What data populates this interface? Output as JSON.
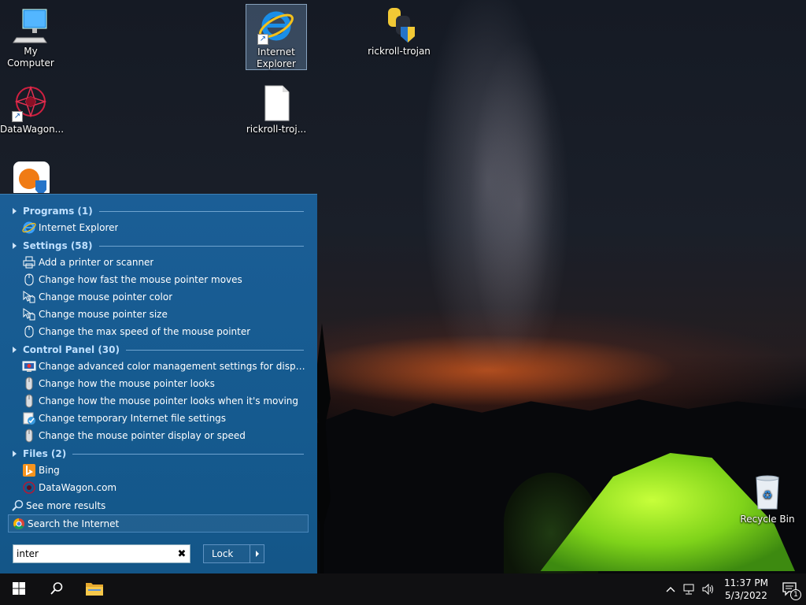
{
  "desktop": {
    "icons": [
      {
        "label": "My Computer"
      },
      {
        "label": "Internet Explorer"
      },
      {
        "label": "rickroll-trojan"
      },
      {
        "label": "DataWagon..."
      },
      {
        "label": "rickroll-troj..."
      },
      {
        "label": "Recycle Bin"
      }
    ]
  },
  "menu": {
    "groups": {
      "programs": "Programs (1)",
      "settings": "Settings (58)",
      "control_panel": "Control Panel (30)",
      "files": "Files (2)"
    },
    "programs": [
      "Internet Explorer"
    ],
    "settings": [
      "Add a printer or scanner",
      "Change how fast the mouse pointer moves",
      "Change mouse pointer color",
      "Change mouse pointer size",
      "Change the max speed of the mouse pointer"
    ],
    "control_panel": [
      "Change advanced color management settings for displays, sca...",
      "Change how the mouse pointer looks",
      "Change how the mouse pointer looks when it's moving",
      "Change temporary Internet file settings",
      "Change the mouse pointer display or speed"
    ],
    "files": [
      "Bing",
      "DataWagon.com"
    ],
    "see_more": "See more results",
    "search_internet": "Search the Internet",
    "search_value": "inter",
    "clear_glyph": "✖",
    "lock_label": "Lock"
  },
  "taskbar": {
    "time": "11:37 PM",
    "date": "5/3/2022",
    "notification_count": "1"
  },
  "icons": {
    "start": "windows-logo-icon",
    "search": "search-icon",
    "explorer": "folder-icon"
  },
  "colors": {
    "menu_bg": "#1b5e96",
    "group_header": "#bfe0ff",
    "taskbar_bg": "#101012"
  }
}
